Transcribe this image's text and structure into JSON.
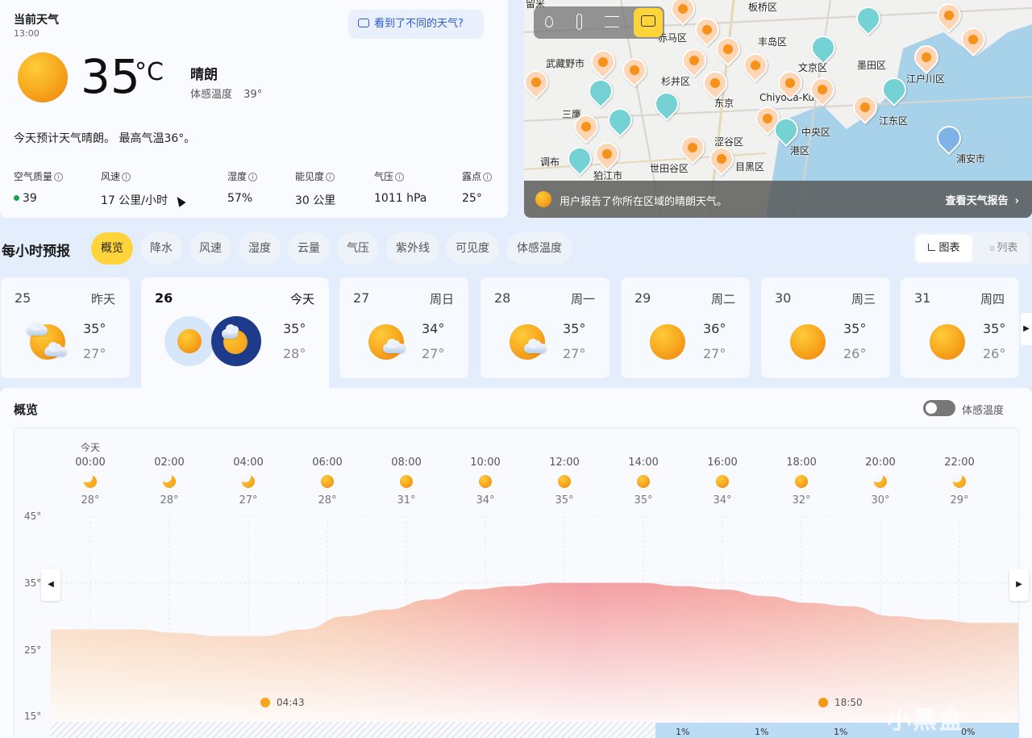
{
  "current": {
    "title": "当前天气",
    "time": "13:00",
    "feedback_label": "看到了不同的天气?",
    "temperature": "35",
    "unit": "°C",
    "condition": "晴朗",
    "feels_label": "体感温度",
    "feels_value": "39°",
    "summary": "今天预计天气晴朗。 最高气温36°。",
    "metrics": [
      {
        "label": "空气质量",
        "value": "39"
      },
      {
        "label": "风速",
        "value": "17 公里/小时"
      },
      {
        "label": "湿度",
        "value": "57%"
      },
      {
        "label": "能见度",
        "value": "30 公里"
      },
      {
        "label": "气压",
        "value": "1011 hPa"
      },
      {
        "label": "露点",
        "value": "25°"
      }
    ],
    "aqi_color": "#1aa34a"
  },
  "map": {
    "labels": [
      "留米",
      "板桥区",
      "赤马区",
      "丰岛区",
      "武藏野市",
      "文京区",
      "墨田区",
      "杉并区",
      "江户川区",
      "东京",
      "Chiyoda-Ku",
      "三鹰",
      "江东区",
      "中央区",
      "涩谷区",
      "港区",
      "调布",
      "世田谷区",
      "目黑区",
      "浦安市",
      "狛江市"
    ],
    "banner_text": "用户报告了你所在区域的晴朗天气。",
    "banner_link": "查看天气报告",
    "toolbar_icons": [
      "droplet-icon",
      "thermometer-icon",
      "wind-icon",
      "chat-icon"
    ]
  },
  "hourly": {
    "title": "每小时预报",
    "tabs": [
      "概览",
      "降水",
      "风速",
      "湿度",
      "云量",
      "气压",
      "紫外线",
      "可见度",
      "体感温度"
    ],
    "active_tab": "概览",
    "view_chart": "图表",
    "view_list": "列表"
  },
  "days": [
    {
      "num": "25",
      "weekday": "昨天",
      "high": "35°",
      "low": "27°",
      "icon": "partly-cloudy"
    },
    {
      "num": "26",
      "weekday": "今天",
      "high": "35°",
      "low": "28°",
      "icon": "sun-and-moon"
    },
    {
      "num": "27",
      "weekday": "周日",
      "high": "34°",
      "low": "27°",
      "icon": "partly-cloudy"
    },
    {
      "num": "28",
      "weekday": "周一",
      "high": "35°",
      "low": "27°",
      "icon": "partly-cloudy"
    },
    {
      "num": "29",
      "weekday": "周二",
      "high": "36°",
      "low": "27°",
      "icon": "sunny"
    },
    {
      "num": "30",
      "weekday": "周三",
      "high": "35°",
      "low": "26°",
      "icon": "sunny"
    },
    {
      "num": "31",
      "weekday": "周四",
      "high": "35°",
      "low": "26°",
      "icon": "sunny"
    }
  ],
  "overview": {
    "title": "概览",
    "toggle_label": "体感温度",
    "today_label": "今天",
    "hours": [
      {
        "time": "00:00",
        "temp": "28°",
        "icon": "moon"
      },
      {
        "time": "02:00",
        "temp": "28°",
        "icon": "moon"
      },
      {
        "time": "04:00",
        "temp": "27°",
        "icon": "moon"
      },
      {
        "time": "06:00",
        "temp": "28°",
        "icon": "sun"
      },
      {
        "time": "08:00",
        "temp": "31°",
        "icon": "sun"
      },
      {
        "time": "10:00",
        "temp": "34°",
        "icon": "sun"
      },
      {
        "time": "12:00",
        "temp": "35°",
        "icon": "sun"
      },
      {
        "time": "14:00",
        "temp": "35°",
        "icon": "sun"
      },
      {
        "time": "16:00",
        "temp": "34°",
        "icon": "sun"
      },
      {
        "time": "18:00",
        "temp": "32°",
        "icon": "sun"
      },
      {
        "time": "20:00",
        "temp": "30°",
        "icon": "moon"
      },
      {
        "time": "22:00",
        "temp": "29°",
        "icon": "moon"
      }
    ],
    "y_ticks": [
      "45°",
      "35°",
      "25°",
      "15°"
    ],
    "sunrise": "04:43",
    "sunset": "18:50",
    "precip": [
      "1%",
      "1%",
      "1%",
      "0%"
    ]
  },
  "chart_data": {
    "type": "area",
    "x": [
      "00:00",
      "01:00",
      "02:00",
      "03:00",
      "04:00",
      "05:00",
      "06:00",
      "07:00",
      "08:00",
      "09:00",
      "10:00",
      "11:00",
      "12:00",
      "13:00",
      "14:00",
      "15:00",
      "16:00",
      "17:00",
      "18:00",
      "19:00",
      "20:00",
      "21:00",
      "22:00",
      "23:00"
    ],
    "series": [
      {
        "values": [
          28,
          28,
          28,
          27.5,
          27,
          27,
          28,
          30,
          31,
          32.5,
          34,
          34.5,
          35,
          35,
          35,
          34.5,
          34,
          33,
          32,
          31.5,
          30,
          29.5,
          29,
          29
        ]
      }
    ],
    "ylim": [
      15,
      45
    ],
    "yticks": [
      "45°",
      "35°",
      "25°",
      "15°"
    ],
    "colors": {
      "hot": "#f39aa0",
      "warm": "#f6c9a4"
    }
  },
  "watermark": "小黑盒"
}
